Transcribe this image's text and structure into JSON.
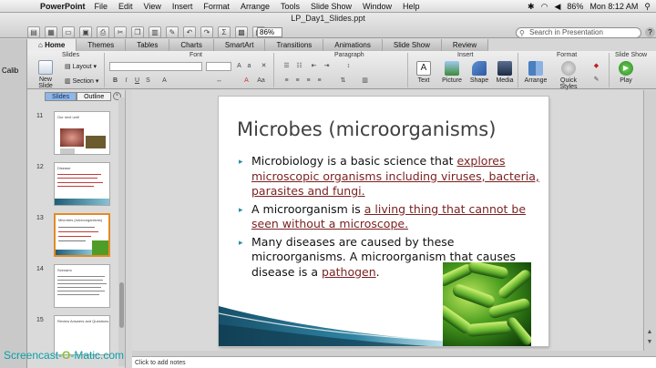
{
  "menubar": {
    "app": "PowerPoint",
    "items": [
      "File",
      "Edit",
      "View",
      "Insert",
      "Format",
      "Arrange",
      "Tools",
      "Slide Show",
      "Window",
      "Help"
    ],
    "battery": "86%",
    "clock": "Mon 8:12 AM"
  },
  "window": {
    "doc_title": "LP_Day1_Slides.ppt",
    "zoom": "86%",
    "search_placeholder": "Search in Presentation"
  },
  "ribbon": {
    "tabs": [
      "Home",
      "Themes",
      "Tables",
      "Charts",
      "SmartArt",
      "Transitions",
      "Animations",
      "Slide Show",
      "Review"
    ],
    "groups": {
      "slides": "Slides",
      "font": "Font",
      "paragraph": "Paragraph",
      "insert": "Insert",
      "format": "Format",
      "slideshow": "Slide Show"
    },
    "new_slide": "New Slide",
    "layout": "Layout",
    "section": "Section",
    "insert_tools": [
      "Text",
      "Picture",
      "Shape",
      "Media"
    ],
    "arrange": "Arrange",
    "quick_styles": "Quick Styles",
    "play": "Play",
    "left_cut": "Calib"
  },
  "panel": {
    "tabs": [
      "Slides",
      "Outline"
    ],
    "thumbs": [
      {
        "num": "11",
        "title": "Our next unit!"
      },
      {
        "num": "12",
        "title": "Disease"
      },
      {
        "num": "13",
        "title": "Microbes (microorganisms)"
      },
      {
        "num": "14",
        "title": "Scenario"
      },
      {
        "num": "15",
        "title": "Review Answers and Questions"
      }
    ]
  },
  "slide": {
    "title": "Microbes (microorganisms)",
    "b1_plain": "Microbiology is a basic science that ",
    "b1_link": "explores microscopic organisms including viruses, bacteria, parasites and fungi.",
    "b2_plain": "A microorganism is ",
    "b2_link": "a living thing that cannot be seen without a microscope.",
    "b3_plain": "Many diseases are caused by these microorganisms. A microorganism that causes disease is a ",
    "b3_link": "pathogen",
    "b3_end": "."
  },
  "notes_placeholder": "Click to add notes",
  "watermark": {
    "a": "Screencast-",
    "b": "O",
    "c": "-Matic.com"
  },
  "colors": {
    "accent": "#2d8aa7",
    "link_text": "#7a1f1f",
    "selected_thumb": "#e58a25"
  }
}
